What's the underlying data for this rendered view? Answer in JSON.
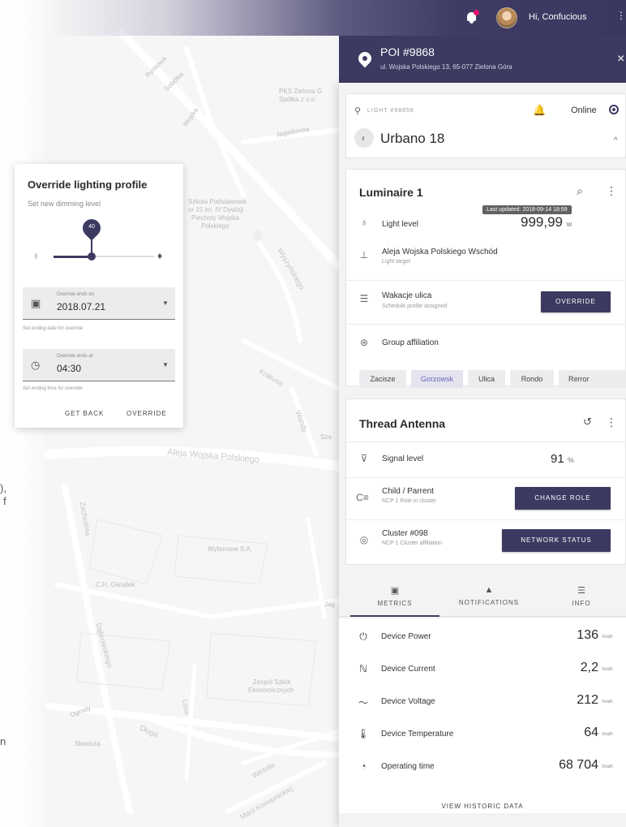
{
  "map": {
    "labels": {
      "rynkowa": "Rynkowa",
      "sobotka": "Sobótka",
      "wojska": "Wojska",
      "pks_1": "PKS Zielona G",
      "pks_2": "Spółka z o.o",
      "szkola_1": "Szkoła Podstawowa",
      "szkola_2": "nr 15 im. IV Dywizji",
      "szkola_3": "Piechoty Wojska",
      "szkola_4": "Polskiego",
      "jagiellonow": "Jagiellonów",
      "wyszynskiego": "Wyszyńskiego",
      "krakusa": "Krakusa",
      "wandy": "Wandy",
      "sza": "Sza",
      "aleja": "Aleja Wojska Polskiego",
      "wyborowa": "Wyborowa S.A.",
      "osrodek": "C.H. Ośrodek",
      "dabrowskiego": "Dąbrowskiego",
      "zespol_1": "Zespół Szkół",
      "zespol_2": "Ekonomicznych",
      "jagi": "Jag",
      "ogrody": "Ogrody",
      "dluga": "Długa",
      "wesola": "Wesoła",
      "konopnickiej": "Marii Konopnickiej",
      "lisia": "Lisia",
      "slowicza": "Słowicza",
      "zachodnia": "Zachodnia"
    },
    "edge_fragments": {
      "comma": "),",
      "f": "f",
      "n": "n"
    }
  },
  "topbar": {
    "greeting": "Hi, Confucious",
    "more_icon": "more-vert-icon",
    "more_glyph": "⋮",
    "notification_dot_color": "#e8136d"
  },
  "poi": {
    "title": "POI #9868",
    "address": "ul. Wojska Polskiego 13, 65-077 Zielona Góra",
    "close_glyph": "×"
  },
  "light": {
    "id_label": "LIGHT #98858",
    "status": "Online",
    "name": "Urbano 18",
    "pin_glyph": "⚲",
    "bell_glyph": "🔔",
    "lamp_glyph": "◐",
    "chevron_glyph": "^"
  },
  "luminaire": {
    "title": "Luminaire 1",
    "tooltip": "Last updated: 2018-09-14 18:59",
    "bulb_glyph": "⌕",
    "more_glyph": "⋮",
    "light_level_label": "Light level",
    "light_level_value": "999,99",
    "light_level_unit": "w",
    "target_name": "Aleja Wojska Polskiego Wschód",
    "target_sub": "Light target",
    "schedule_name": "Wakacje ulica",
    "schedule_sub": "Schedule profile assigned",
    "override_btn": "OVERRIDE",
    "group_label": "Group affiliation",
    "chips": [
      "Zacisze",
      "Gorzowsk",
      "Ulica",
      "Rondo",
      "Rerror"
    ],
    "icons": {
      "bulb": "♁",
      "target": "⊥",
      "schedule": "☰",
      "group": "⊛"
    }
  },
  "thread": {
    "title": "Thread Antenna",
    "history_glyph": "↺",
    "more_glyph": "⋮",
    "signal_label": "Signal level",
    "signal_value": "91",
    "signal_unit": "%",
    "child_name": "Child / Parrent",
    "child_sub": "NCP 1 Role in cluster",
    "change_role_btn": "CHANGE ROLE",
    "cluster_name": "Cluster #098",
    "cluster_sub": "NCP 1 Cluster affiliation",
    "network_btn": "NETWORK STATUS",
    "icons": {
      "wifi": "⊽",
      "child": "C≡",
      "cluster": "◎"
    }
  },
  "tabs": [
    {
      "label": "METRICS",
      "icon": "▣"
    },
    {
      "label": "NOTIFICATIONS",
      "icon": "▲"
    },
    {
      "label": "INFO",
      "icon": "☰"
    }
  ],
  "metrics": [
    {
      "label": "Device Power",
      "value": "136",
      "unit": "kvah",
      "icon": "⏻"
    },
    {
      "label": "Device Current",
      "value": "2,2",
      "unit": "kvah",
      "icon": "ℕ"
    },
    {
      "label": "Device Voltage",
      "value": "212",
      "unit": "kvah",
      "icon": "〜"
    },
    {
      "label": "Device Temperature",
      "value": "64",
      "unit": "kvah",
      "icon": "🌡"
    },
    {
      "label": "Operating time",
      "value": "68 704",
      "unit": "kvah",
      "icon": "◔"
    }
  ],
  "view_historic": "VIEW HISTORIC DATA",
  "override_dialog": {
    "title": "Override lighting profile",
    "subtitle": "Set new dimming level",
    "slider_value": "40",
    "slider_level": 0.4,
    "date_label": "Override ends on",
    "date_value": "2018.07.21",
    "date_help": "Set ending date for override",
    "time_label": "Override ends at",
    "time_value": "04:30",
    "time_help": "Set ending time for override",
    "get_back_btn": "GET BACK",
    "override_btn": "OVERRIDE",
    "icons": {
      "bulb_off": "♁",
      "bulb_on": "♦",
      "calendar": "▣",
      "clock": "◷",
      "caret": "▼"
    }
  }
}
